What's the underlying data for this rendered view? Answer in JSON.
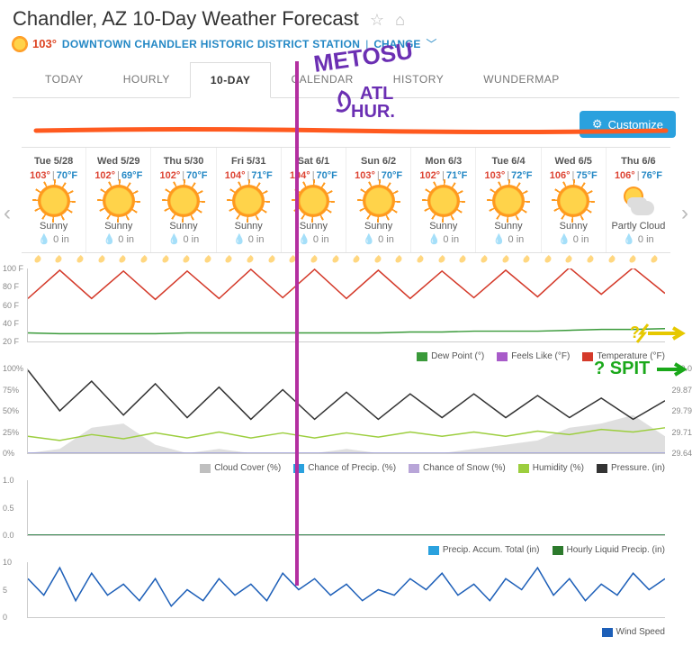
{
  "header": {
    "title": "Chandler, AZ 10-Day Weather Forecast",
    "current_temp": "103°",
    "station": "DOWNTOWN CHANDLER HISTORIC DISTRICT STATION",
    "change_label": "CHANGE"
  },
  "tabs": {
    "today": "TODAY",
    "hourly": "HOURLY",
    "tenday": "10-DAY",
    "calendar": "CALENDAR",
    "history": "HISTORY",
    "wundermap": "WUNDERMAP"
  },
  "customize_label": "Customize",
  "days": [
    {
      "name": "Tue 5/28",
      "hi": "103°",
      "lo": "70°F",
      "cond": "Sunny",
      "precip": "0 in",
      "icon": "sun"
    },
    {
      "name": "Wed 5/29",
      "hi": "102°",
      "lo": "69°F",
      "cond": "Sunny",
      "precip": "0 in",
      "icon": "sun"
    },
    {
      "name": "Thu 5/30",
      "hi": "102°",
      "lo": "70°F",
      "cond": "Sunny",
      "precip": "0 in",
      "icon": "sun"
    },
    {
      "name": "Fri 5/31",
      "hi": "104°",
      "lo": "71°F",
      "cond": "Sunny",
      "precip": "0 in",
      "icon": "sun"
    },
    {
      "name": "Sat 6/1",
      "hi": "104°",
      "lo": "70°F",
      "cond": "Sunny",
      "precip": "0 in",
      "icon": "sun"
    },
    {
      "name": "Sun 6/2",
      "hi": "103°",
      "lo": "70°F",
      "cond": "Sunny",
      "precip": "0 in",
      "icon": "sun"
    },
    {
      "name": "Mon 6/3",
      "hi": "102°",
      "lo": "71°F",
      "cond": "Sunny",
      "precip": "0 in",
      "icon": "sun"
    },
    {
      "name": "Tue 6/4",
      "hi": "103°",
      "lo": "72°F",
      "cond": "Sunny",
      "precip": "0 in",
      "icon": "sun"
    },
    {
      "name": "Wed 6/5",
      "hi": "106°",
      "lo": "75°F",
      "cond": "Sunny",
      "precip": "0 in",
      "icon": "sun"
    },
    {
      "name": "Thu 6/6",
      "hi": "106°",
      "lo": "76°F",
      "cond": "Partly Cloud",
      "precip": "0 in",
      "icon": "pcloud"
    }
  ],
  "chart_data": [
    {
      "type": "line",
      "title": "Temperature",
      "ylabels_left": [
        "100 F",
        "80 F",
        "60 F",
        "40 F",
        "20 F"
      ],
      "ylim": [
        20,
        105
      ],
      "series": [
        {
          "name": "Temperature (°F)",
          "color": "#d43a2a",
          "values": [
            70,
            103,
            70,
            102,
            69,
            102,
            70,
            104,
            71,
            104,
            70,
            103,
            70,
            102,
            71,
            103,
            72,
            106,
            75,
            106,
            76
          ]
        },
        {
          "name": "Dew Point (°)",
          "color": "#3a9a3a",
          "values": [
            30,
            29,
            29,
            29,
            29,
            30,
            30,
            30,
            30,
            30,
            30,
            30,
            31,
            31,
            32,
            32,
            32,
            33,
            34,
            34,
            35
          ]
        },
        {
          "name": "Feels Like (°F)",
          "color": "#a85bc9",
          "values": []
        }
      ],
      "legend": [
        {
          "label": "Dew Point (°)",
          "color": "#3a9a3a"
        },
        {
          "label": "Feels Like (°F)",
          "color": "#a85bc9"
        },
        {
          "label": "Temperature (°F)",
          "color": "#d43a2a"
        }
      ]
    },
    {
      "type": "line",
      "title": "Humidity/Pressure/Cloud",
      "ylabels_left": [
        "100%",
        "75%",
        "50%",
        "25%",
        "0%"
      ],
      "ylabels_right": [
        "30.0",
        "29.87",
        "29.79",
        "29.71",
        "29.64"
      ],
      "ylim": [
        0,
        100
      ],
      "series": [
        {
          "name": "Cloud Cover (%)",
          "color": "#bfbfbf",
          "style": "area",
          "values": [
            0,
            5,
            30,
            35,
            10,
            0,
            5,
            0,
            0,
            0,
            5,
            0,
            0,
            0,
            5,
            10,
            15,
            30,
            35,
            45,
            20
          ]
        },
        {
          "name": "Humidity (%)",
          "color": "#9cce3e",
          "values": [
            20,
            15,
            22,
            17,
            24,
            18,
            25,
            18,
            24,
            18,
            24,
            19,
            25,
            20,
            25,
            20,
            26,
            22,
            28,
            25,
            30
          ]
        },
        {
          "name": "Pressure. (in)",
          "color": "#333",
          "values_axis": "right",
          "values": [
            98,
            50,
            85,
            45,
            82,
            42,
            78,
            40,
            75,
            40,
            72,
            40,
            70,
            42,
            70,
            42,
            68,
            42,
            65,
            40,
            62
          ]
        },
        {
          "name": "Chance of Precip. (%)",
          "color": "#2aa1de",
          "values": [
            0,
            0,
            0,
            0,
            0,
            0,
            0,
            0,
            0,
            0,
            0,
            0,
            0,
            0,
            0,
            0,
            0,
            0,
            0,
            0,
            0
          ]
        },
        {
          "name": "Chance of Snow (%)",
          "color": "#b8a5d8",
          "values": [
            0,
            0,
            0,
            0,
            0,
            0,
            0,
            0,
            0,
            0,
            0,
            0,
            0,
            0,
            0,
            0,
            0,
            0,
            0,
            0,
            0
          ]
        }
      ],
      "legend": [
        {
          "label": "Cloud Cover (%)",
          "color": "#bfbfbf"
        },
        {
          "label": "Chance of Precip. (%)",
          "color": "#2aa1de"
        },
        {
          "label": "Chance of Snow (%)",
          "color": "#b8a5d8"
        },
        {
          "label": "Humidity (%)",
          "color": "#9cce3e"
        },
        {
          "label": "Pressure. (in)",
          "color": "#333"
        }
      ]
    },
    {
      "type": "line",
      "title": "Precipitation",
      "ylabels_left": [
        "1.0",
        "0.5",
        "0.0"
      ],
      "ylim": [
        0,
        1
      ],
      "series": [
        {
          "name": "Precip. Accum. Total (in)",
          "color": "#2aa1de",
          "values": [
            0,
            0,
            0,
            0,
            0,
            0,
            0,
            0,
            0,
            0,
            0,
            0,
            0,
            0,
            0,
            0,
            0,
            0,
            0,
            0,
            0
          ]
        },
        {
          "name": "Hourly Liquid Precip. (in)",
          "color": "#2c7a2c",
          "values": [
            0,
            0,
            0,
            0,
            0,
            0,
            0,
            0,
            0,
            0,
            0,
            0,
            0,
            0,
            0,
            0,
            0,
            0,
            0,
            0,
            0
          ]
        }
      ],
      "legend": [
        {
          "label": "Precip. Accum. Total (in)",
          "color": "#2aa1de"
        },
        {
          "label": "Hourly Liquid Precip. (in)",
          "color": "#2c7a2c"
        }
      ]
    },
    {
      "type": "line",
      "title": "Wind",
      "ylabels_left": [
        "10",
        "5",
        "0"
      ],
      "ylim": [
        0,
        10
      ],
      "series": [
        {
          "name": "Wind Speed",
          "color": "#1d5fb8",
          "values": [
            7,
            4,
            9,
            3,
            8,
            4,
            6,
            3,
            7,
            2,
            5,
            3,
            7,
            4,
            6,
            3,
            8,
            5,
            7,
            4,
            6,
            3,
            5,
            4,
            7,
            5,
            8,
            4,
            6,
            3,
            7,
            5,
            9,
            4,
            7,
            3,
            6,
            4,
            8,
            5,
            7
          ]
        }
      ],
      "legend": [
        {
          "label": "Wind Speed",
          "color": "#1d5fb8"
        }
      ]
    }
  ],
  "annotations": {
    "text1": "METOSU",
    "text2": "ATL",
    "text3": "HUR.",
    "text4": "? SPIT"
  }
}
